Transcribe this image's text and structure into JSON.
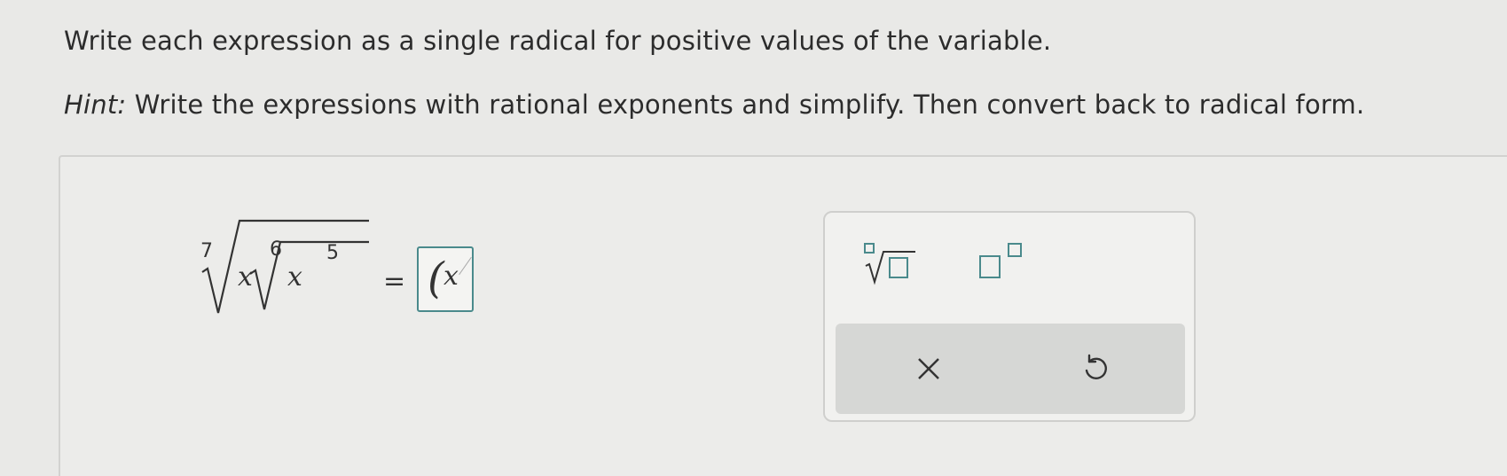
{
  "question": {
    "instructions": "Write each expression as a single radical for positive values of the variable.",
    "hint_label": "Hint:",
    "hint_text": " Write the expressions with rational exponents and simplify. Then convert back to radical form."
  },
  "expression": {
    "outer_index": "7",
    "outer_coefficient": "x",
    "inner_index": "6",
    "inner_base": "x",
    "inner_exponent": "5",
    "equals": "="
  },
  "answer": {
    "open_paren": "(",
    "value": "x"
  },
  "toolbox": {
    "tools": [
      {
        "name": "nth-root",
        "icon": "nth-root-template-icon"
      },
      {
        "name": "exponent",
        "icon": "exponent-template-icon"
      }
    ],
    "actions": [
      {
        "name": "clear",
        "icon": "x-icon"
      },
      {
        "name": "undo",
        "icon": "undo-icon"
      }
    ],
    "accent_color": "#4a8a8c"
  }
}
